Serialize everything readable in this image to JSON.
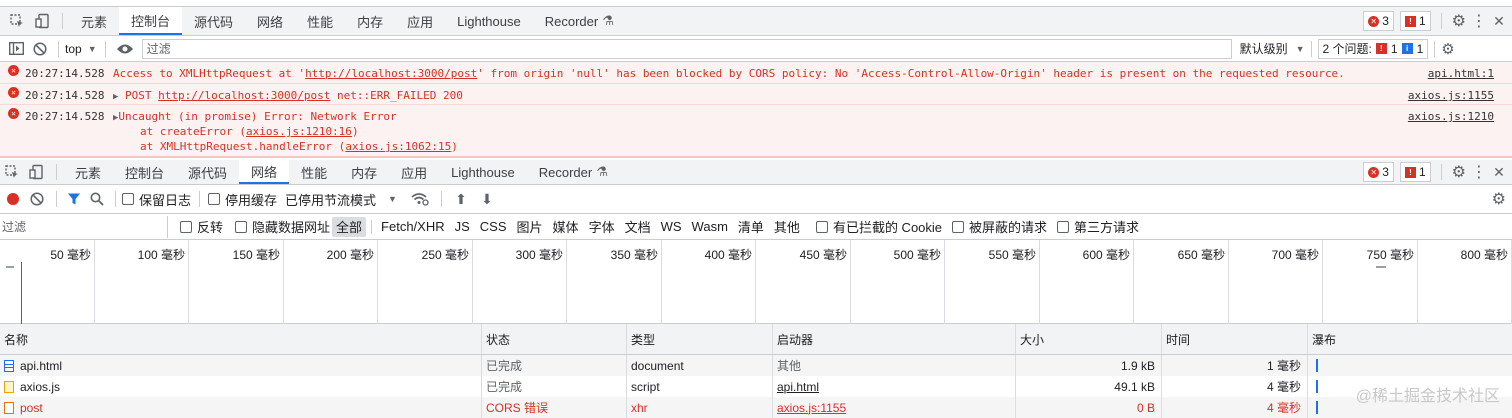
{
  "top_tabs": [
    "元素",
    "控制台",
    "源代码",
    "网络",
    "性能",
    "内存",
    "应用",
    "Lighthouse",
    "Recorder"
  ],
  "top_badges": {
    "errors": "3",
    "issues": "1"
  },
  "console_toolbar": {
    "context": "top",
    "filter_placeholder": "过滤",
    "levels": "默认级别",
    "issues_label": "2 个问题:",
    "issues_err": "1",
    "issues_info": "1"
  },
  "console_messages": [
    {
      "time": "20:27:14.528",
      "text_pre": "Access to XMLHttpRequest at '",
      "url": "http://localhost:3000/post",
      "text_post": "' from origin 'null' has been blocked by CORS policy: No 'Access-Control-Allow-Origin' header is present on the requested resource.",
      "source": "api.html:1"
    },
    {
      "time": "20:27:14.528",
      "method": "POST",
      "url": "http://localhost:3000/post",
      "text_post": "net::ERR_FAILED 200",
      "source": "axios.js:1155"
    },
    {
      "time": "20:27:14.528",
      "line1": "Uncaught (in promise) Error: Network Error",
      "line2_pre": "at createError (",
      "line2_link": "axios.js:1210:16",
      "line2_post": ")",
      "line3_pre": "at XMLHttpRequest.handleError (",
      "line3_link": "axios.js:1062:15",
      "line3_post": ")",
      "source": "axios.js:1210"
    }
  ],
  "net_tabs": [
    "元素",
    "控制台",
    "源代码",
    "网络",
    "性能",
    "内存",
    "应用",
    "Lighthouse",
    "Recorder"
  ],
  "net_badges": {
    "errors": "3",
    "issues": "1"
  },
  "net_toolbar": {
    "preserve_log": "保留日志",
    "disable_cache": "停用缓存",
    "throttle": "已停用节流模式"
  },
  "net_filter": {
    "placeholder": "过滤",
    "invert": "反转",
    "hide_data_urls": "隐藏数据网址",
    "types": [
      "全部",
      "Fetch/XHR",
      "JS",
      "CSS",
      "图片",
      "媒体",
      "字体",
      "文档",
      "WS",
      "Wasm",
      "清单",
      "其他"
    ],
    "blocked_cookies": "有已拦截的 Cookie",
    "blocked_requests": "被屏蔽的请求",
    "third_party": "第三方请求"
  },
  "timeline_ticks": [
    "50 毫秒",
    "100 毫秒",
    "150 毫秒",
    "200 毫秒",
    "250 毫秒",
    "300 毫秒",
    "350 毫秒",
    "400 毫秒",
    "450 毫秒",
    "500 毫秒",
    "550 毫秒",
    "600 毫秒",
    "650 毫秒",
    "700 毫秒",
    "750 毫秒",
    "800 毫秒"
  ],
  "table": {
    "headers": [
      "名称",
      "状态",
      "类型",
      "启动器",
      "大小",
      "时间",
      "瀑布"
    ],
    "rows": [
      {
        "name": "api.html",
        "status": "已完成",
        "type": "document",
        "initiator": "其他",
        "size": "1.9 kB",
        "time": "1 毫秒",
        "error": false
      },
      {
        "name": "axios.js",
        "status": "已完成",
        "type": "script",
        "initiator": "api.html",
        "size": "49.1 kB",
        "time": "4 毫秒",
        "error": false
      },
      {
        "name": "post",
        "status": "CORS 错误",
        "type": "xhr",
        "initiator": "axios.js:1155",
        "size": "0 B",
        "time": "4 毫秒",
        "error": true
      }
    ]
  },
  "watermark": "@稀土掘金技术社区"
}
